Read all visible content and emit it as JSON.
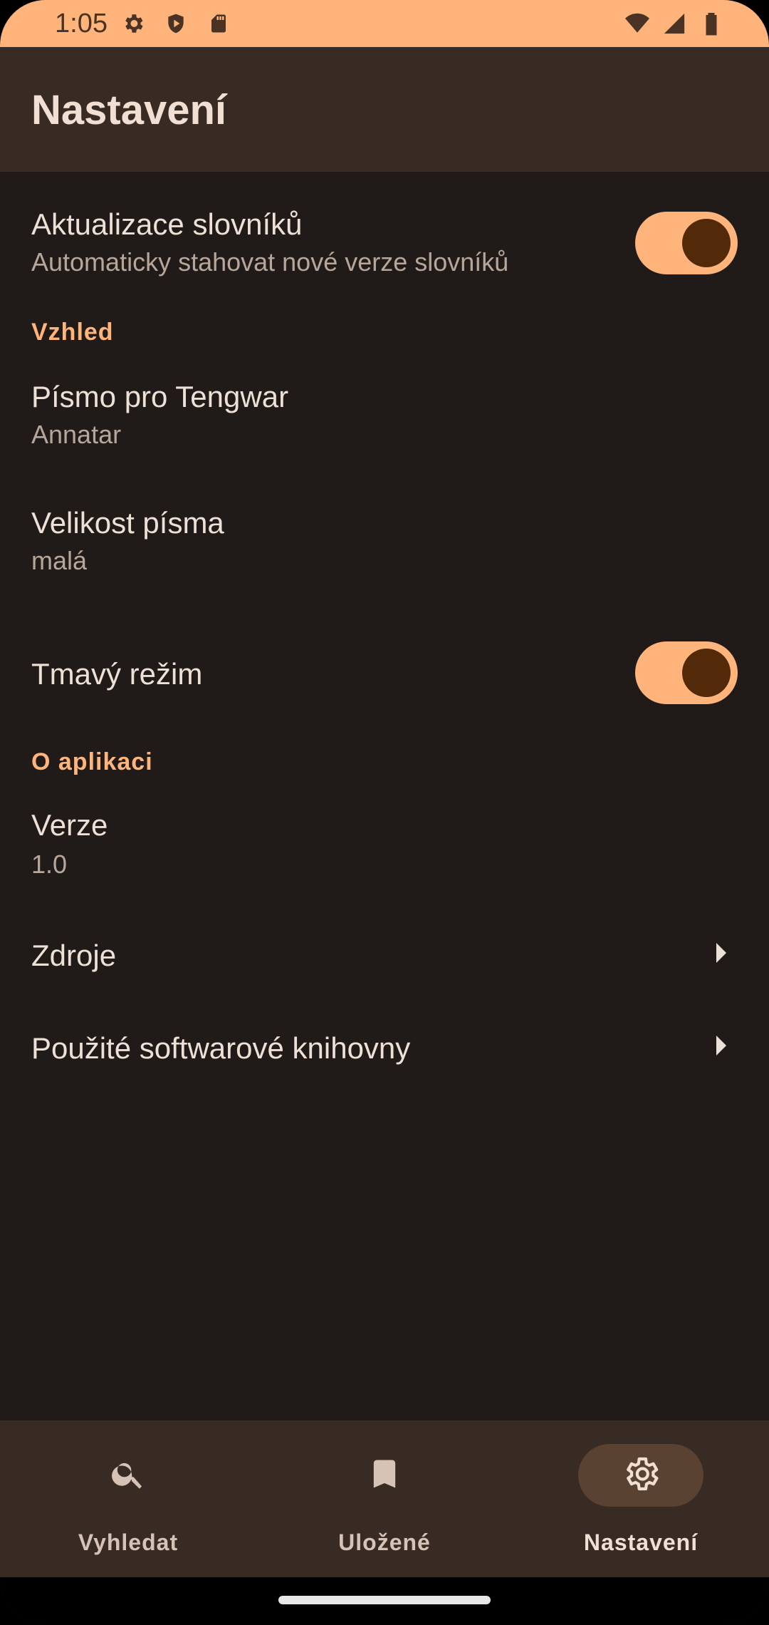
{
  "status_bar": {
    "time": "1:05",
    "icons_left": [
      "gear-icon",
      "shield-play-icon",
      "sd-card-icon"
    ],
    "icons_right": [
      "wifi-icon",
      "signal-icon",
      "battery-icon"
    ]
  },
  "app_bar": {
    "title": "Nastavení"
  },
  "preferences": {
    "dictionary_updates": {
      "title": "Aktualizace slovníků",
      "summary": "Automaticky stahovat nové verze slovníků",
      "enabled": true
    },
    "appearance_category": "Vzhled",
    "tengwar_font": {
      "title": "Písmo pro Tengwar",
      "value": "Annatar"
    },
    "font_size": {
      "title": "Velikost písma",
      "value": "malá"
    },
    "dark_mode": {
      "title": "Tmavý režim",
      "enabled": true
    },
    "about_category": "O aplikaci",
    "version": {
      "title": "Verze",
      "value": "1.0"
    },
    "sources": {
      "title": "Zdroje"
    },
    "libraries": {
      "title": "Použité softwarové knihovny"
    }
  },
  "bottom_nav": {
    "items": [
      {
        "label": "Vyhledat",
        "icon": "search-icon",
        "active": false
      },
      {
        "label": "Uložené",
        "icon": "bookmark-icon",
        "active": false
      },
      {
        "label": "Nastavení",
        "icon": "settings-icon",
        "active": true
      }
    ]
  },
  "colors": {
    "accent": "#ffb47c",
    "background": "#201b18",
    "surface": "#372b23"
  }
}
